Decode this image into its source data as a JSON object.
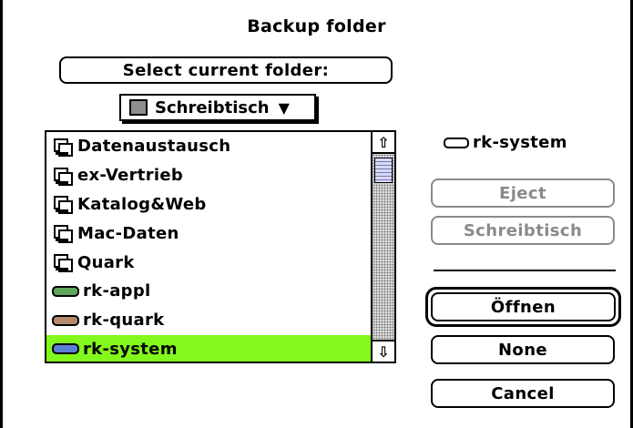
{
  "dialog": {
    "title": "Backup folder",
    "select_button": "Select current folder:",
    "location_popup": {
      "selected": "Schreibtisch",
      "arrow": "▼"
    }
  },
  "file_list": {
    "items": [
      {
        "label": "Datenaustausch",
        "icon": "shared-folder-icon"
      },
      {
        "label": "ex-Vertrieb",
        "icon": "shared-folder-icon"
      },
      {
        "label": "Katalog&Web",
        "icon": "shared-folder-icon"
      },
      {
        "label": "Mac-Daten",
        "icon": "shared-folder-icon"
      },
      {
        "label": "Quark",
        "icon": "shared-folder-icon"
      },
      {
        "label": "rk-appl",
        "icon": "volume-icon",
        "icon_color": "#5fa65a"
      },
      {
        "label": "rk-quark",
        "icon": "volume-icon",
        "icon_color": "#b58a6a"
      },
      {
        "label": "rk-system",
        "icon": "volume-icon",
        "icon_color": "#5b7fd6",
        "selected": true
      }
    ],
    "selection_color": "#82f81c",
    "scroll_up": "⇧",
    "scroll_down": "⇩"
  },
  "volume": {
    "label": "rk-system",
    "icon": "volume-icon"
  },
  "buttons": {
    "eject": "Eject",
    "desktop": "Schreibtisch",
    "open": "Öffnen",
    "none": "None",
    "cancel": "Cancel"
  }
}
